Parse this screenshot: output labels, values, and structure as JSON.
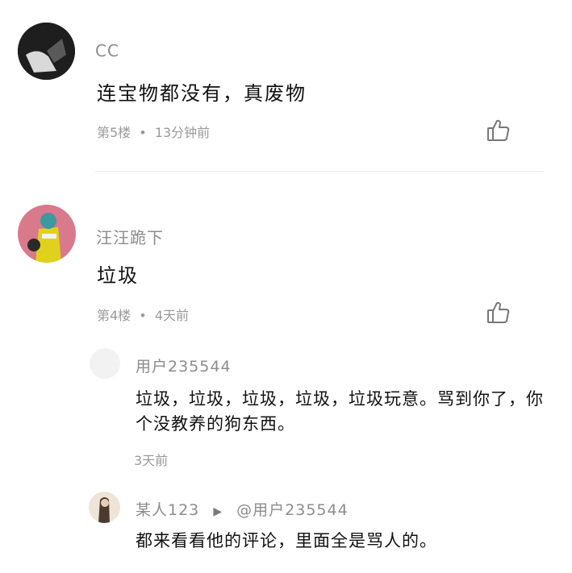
{
  "comments": [
    {
      "username": "CC",
      "text": "连宝物都没有，真废物",
      "floor": "第5楼",
      "dot": "•",
      "time": "13分钟前"
    },
    {
      "username": "汪汪跪下",
      "text": "垃圾",
      "floor": "第4楼",
      "dot": "•",
      "time": "4天前",
      "replies": [
        {
          "username": "用户235544",
          "text": "垃圾，垃圾，垃圾，垃圾，垃圾玩意。骂到你了，你个没教养的狗东西。",
          "time": "3天前"
        },
        {
          "username": "某人123",
          "reply_to": "@用户235544",
          "text": "都来看看他的评论，里面全是骂人的。"
        }
      ]
    }
  ],
  "colors": {
    "username": "#8c8c8c",
    "text": "#111111",
    "meta": "#9a9a9a",
    "divider": "#ececec",
    "icon": "#777777"
  },
  "icons": {
    "like": "thumbs-up-icon",
    "reply_arrow": "play-triangle-icon"
  }
}
